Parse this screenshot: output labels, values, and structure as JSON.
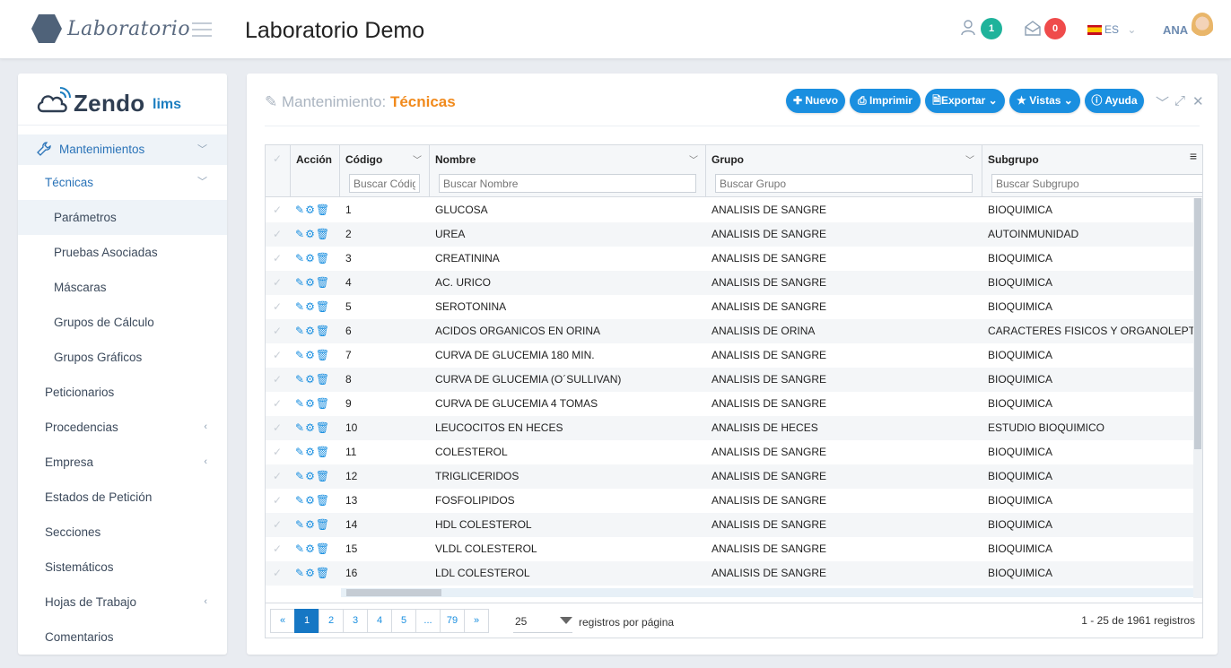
{
  "header": {
    "logo_text": "Laboratorio",
    "title": "Laboratorio Demo",
    "users_badge": "1",
    "messages_badge": "0",
    "language": "ES",
    "user": "ANA",
    "colors": {
      "teal": "#1fb39b",
      "red": "#ef4b4b",
      "brand": "#4f6279"
    }
  },
  "sidebar": {
    "brand": "Zendo",
    "brand_suffix": "lims",
    "items": [
      {
        "label": "Mantenimientos",
        "level": "main",
        "chevron": "down"
      },
      {
        "label": "Técnicas",
        "level": "sub",
        "chevron": "down"
      },
      {
        "label": "Parámetros",
        "level": "sub2",
        "active": true
      },
      {
        "label": "Pruebas Asociadas",
        "level": "sub2"
      },
      {
        "label": "Máscaras",
        "level": "sub2"
      },
      {
        "label": "Grupos de Cálculo",
        "level": "sub2"
      },
      {
        "label": "Grupos Gráficos",
        "level": "sub2"
      },
      {
        "label": "Peticionarios",
        "level": "sub"
      },
      {
        "label": "Procedencias",
        "level": "sub",
        "chevron": "left"
      },
      {
        "label": "Empresa",
        "level": "sub",
        "chevron": "left"
      },
      {
        "label": "Estados de Petición",
        "level": "sub"
      },
      {
        "label": "Secciones",
        "level": "sub"
      },
      {
        "label": "Sistemáticos",
        "level": "sub"
      },
      {
        "label": "Hojas de Trabajo",
        "level": "sub",
        "chevron": "left"
      },
      {
        "label": "Comentarios",
        "level": "sub"
      }
    ]
  },
  "panel": {
    "title_prefix": "Mantenimiento:",
    "title_main": "Técnicas",
    "buttons": {
      "nuevo": "Nuevo",
      "imprimir": "Imprimir",
      "exportar": "Exportar",
      "vistas": "Vistas",
      "ayuda": "Ayuda"
    }
  },
  "grid": {
    "columns": {
      "accion": "Acción",
      "codigo": "Código",
      "nombre": "Nombre",
      "grupo": "Grupo",
      "subgrupo": "Subgrupo"
    },
    "filters": {
      "codigo": "Buscar Código",
      "nombre": "Buscar Nombre",
      "grupo": "Buscar Grupo",
      "subgrupo": "Buscar Subgrupo"
    },
    "rows": [
      {
        "codigo": "1",
        "nombre": "GLUCOSA",
        "grupo": "ANALISIS DE SANGRE",
        "subgrupo": "BIOQUIMICA"
      },
      {
        "codigo": "2",
        "nombre": "UREA",
        "grupo": "ANALISIS DE SANGRE",
        "subgrupo": "AUTOINMUNIDAD"
      },
      {
        "codigo": "3",
        "nombre": "CREATININA",
        "grupo": "ANALISIS DE SANGRE",
        "subgrupo": "BIOQUIMICA"
      },
      {
        "codigo": "4",
        "nombre": "AC. URICO",
        "grupo": "ANALISIS DE SANGRE",
        "subgrupo": "BIOQUIMICA"
      },
      {
        "codigo": "5",
        "nombre": "SEROTONINA",
        "grupo": "ANALISIS DE SANGRE",
        "subgrupo": "BIOQUIMICA"
      },
      {
        "codigo": "6",
        "nombre": "ACIDOS ORGANICOS EN ORINA",
        "grupo": "ANALISIS DE ORINA",
        "subgrupo": "CARACTERES FISICOS Y ORGANOLEPTICOS"
      },
      {
        "codigo": "7",
        "nombre": "CURVA DE GLUCEMIA 180 MIN.",
        "grupo": "ANALISIS DE SANGRE",
        "subgrupo": "BIOQUIMICA"
      },
      {
        "codigo": "8",
        "nombre": "CURVA DE GLUCEMIA (O´SULLIVAN)",
        "grupo": "ANALISIS DE SANGRE",
        "subgrupo": "BIOQUIMICA"
      },
      {
        "codigo": "9",
        "nombre": "CURVA DE GLUCEMIA 4 TOMAS",
        "grupo": "ANALISIS DE SANGRE",
        "subgrupo": "BIOQUIMICA"
      },
      {
        "codigo": "10",
        "nombre": "LEUCOCITOS EN HECES",
        "grupo": "ANALISIS DE HECES",
        "subgrupo": "ESTUDIO BIOQUIMICO"
      },
      {
        "codigo": "11",
        "nombre": "COLESTEROL",
        "grupo": "ANALISIS DE SANGRE",
        "subgrupo": "BIOQUIMICA"
      },
      {
        "codigo": "12",
        "nombre": "TRIGLICERIDOS",
        "grupo": "ANALISIS DE SANGRE",
        "subgrupo": "BIOQUIMICA"
      },
      {
        "codigo": "13",
        "nombre": "FOSFOLIPIDOS",
        "grupo": "ANALISIS DE SANGRE",
        "subgrupo": "BIOQUIMICA"
      },
      {
        "codigo": "14",
        "nombre": "HDL COLESTEROL",
        "grupo": "ANALISIS DE SANGRE",
        "subgrupo": "BIOQUIMICA"
      },
      {
        "codigo": "15",
        "nombre": "VLDL COLESTEROL",
        "grupo": "ANALISIS DE SANGRE",
        "subgrupo": "BIOQUIMICA"
      },
      {
        "codigo": "16",
        "nombre": "LDL COLESTEROL",
        "grupo": "ANALISIS DE SANGRE",
        "subgrupo": "BIOQUIMICA"
      }
    ]
  },
  "pagination": {
    "first": "«",
    "pages": [
      "1",
      "2",
      "3",
      "4",
      "5",
      "...",
      "79"
    ],
    "current": "1",
    "next": "»",
    "per_page": "25",
    "per_page_label": "registros por página",
    "summary": "1 - 25 de 1961 registros"
  }
}
